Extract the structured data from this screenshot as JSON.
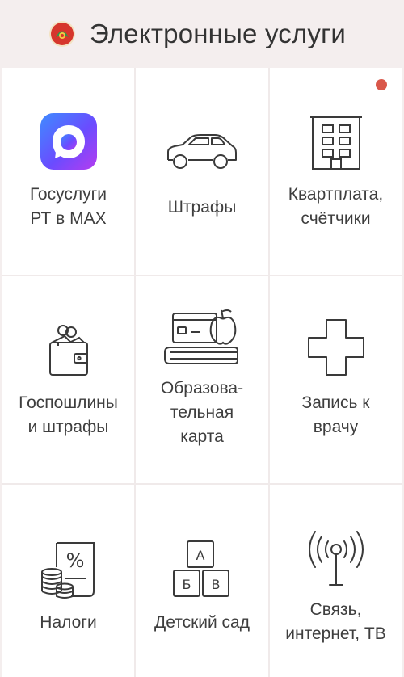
{
  "header": {
    "title": "Электронные услуги",
    "logo_icon": "tatarstan-emblem-icon"
  },
  "colors": {
    "background": "#f4eeee",
    "tile": "#ffffff",
    "notification_dot": "#d9574a",
    "icon_stroke": "#3a3a3a"
  },
  "tiles": [
    {
      "label": "Госуслуги\nРТ в MAX",
      "icon": "max-app-icon"
    },
    {
      "label": "Штрафы",
      "icon": "car-icon"
    },
    {
      "label": "Квартплата,\nсчётчики",
      "icon": "apartment-building-icon",
      "has_notification": true
    },
    {
      "label": "Госпошлины\nи штрафы",
      "icon": "wallet-coins-icon"
    },
    {
      "label": "Образова-\nтельная\nкарта",
      "icon": "education-card-icon"
    },
    {
      "label": "Запись к\nврачу",
      "icon": "medical-cross-icon"
    },
    {
      "label": "Налоги",
      "icon": "tax-percent-icon"
    },
    {
      "label": "Детский сад",
      "icon": "abc-blocks-icon",
      "blocks": [
        "А",
        "Б",
        "В"
      ]
    },
    {
      "label": "Связь,\nинтернет, ТВ",
      "icon": "antenna-icon"
    }
  ]
}
